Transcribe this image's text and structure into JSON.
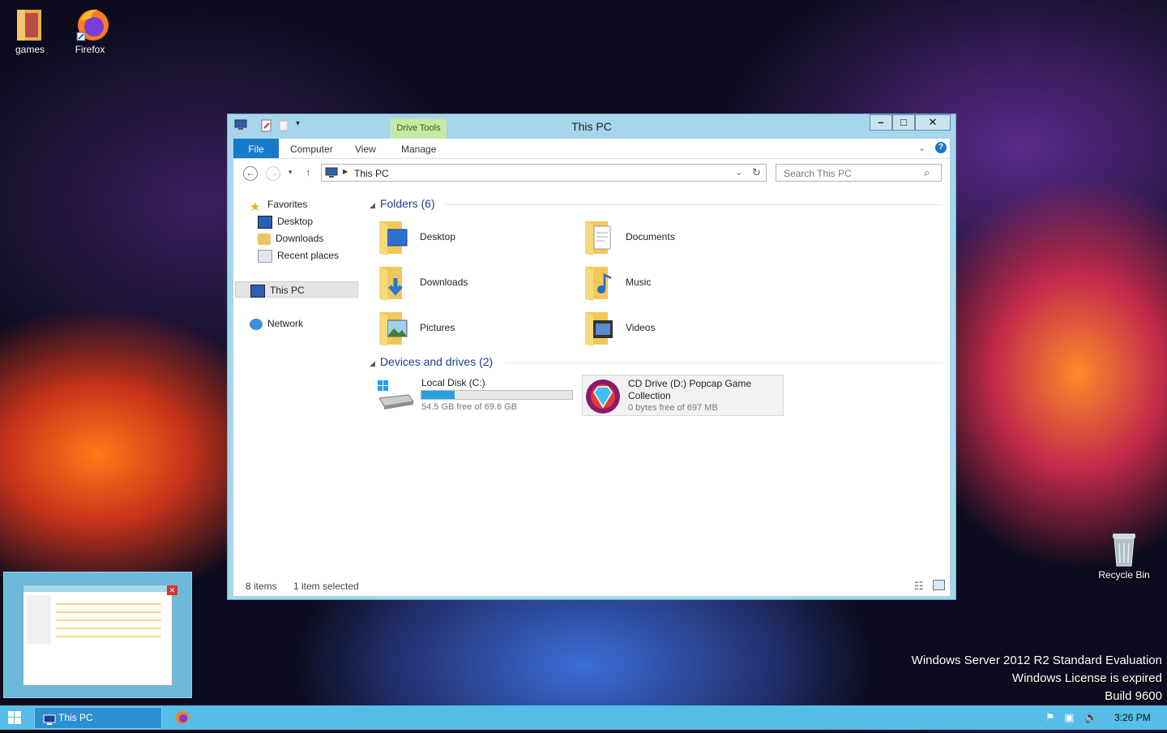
{
  "desktop": {
    "icons": [
      {
        "label": "games"
      },
      {
        "label": "Firefox"
      },
      {
        "label": "Recycle Bin"
      }
    ],
    "watermark": [
      "Windows Server 2012 R2 Standard Evaluation",
      "Windows License is expired",
      "Build 9600"
    ]
  },
  "window": {
    "title": "This PC",
    "contextual_tab": "Drive Tools",
    "controls": {
      "minimize": "–",
      "maximize": "□",
      "close": "✕"
    },
    "ribbon_tabs": [
      "File",
      "Computer",
      "View",
      "Manage"
    ],
    "address": {
      "path": "This PC"
    },
    "search": {
      "placeholder": "Search This PC"
    },
    "nav": {
      "favorites": "Favorites",
      "favorites_items": [
        "Desktop",
        "Downloads",
        "Recent places"
      ],
      "this_pc": "This PC",
      "network": "Network"
    },
    "folders_header": "Folders (6)",
    "folders": [
      "Desktop",
      "Documents",
      "Downloads",
      "Music",
      "Pictures",
      "Videos"
    ],
    "devices_header": "Devices and drives (2)",
    "drives": [
      {
        "name": "Local Disk (C:)",
        "free": "54.5 GB free of 69.6 GB",
        "used_fraction": 0.22
      },
      {
        "name_line1": "CD Drive (D:) Popcap Game",
        "name_line2": "Collection",
        "free": "0 bytes free of 697 MB"
      }
    ],
    "status": {
      "items": "8 items",
      "selected": "1 item selected"
    }
  },
  "taskbar": {
    "active_window": "This PC",
    "clock": "3:26 PM"
  },
  "colors": {
    "accent": "#1979ca",
    "window_frame": "#a7d5ec",
    "taskbar": "#55bde6",
    "drive_bar": "#26a0da"
  }
}
